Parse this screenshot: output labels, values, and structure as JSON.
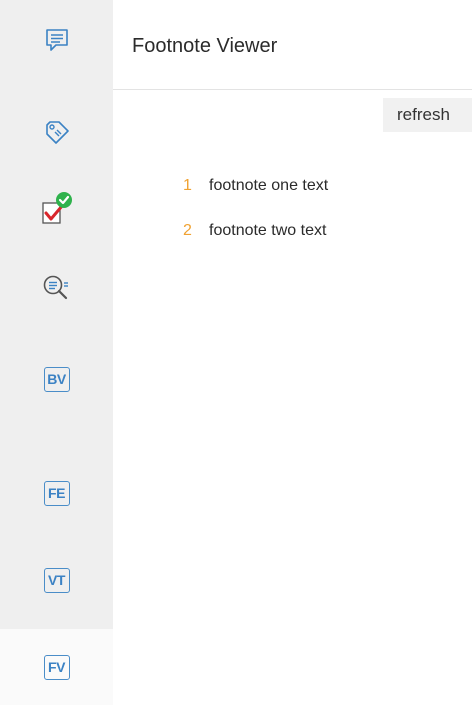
{
  "rail": {
    "items": [
      {
        "icon": "comment-lines-icon",
        "active": false
      },
      {
        "icon": "tag-icon",
        "active": false
      },
      {
        "icon": "checklist-done-icon",
        "active": false
      },
      {
        "icon": "search-list-icon",
        "active": false
      },
      {
        "label": "BV",
        "active": false
      },
      {
        "label": "FE",
        "active": false
      },
      {
        "label": "VT",
        "active": false
      },
      {
        "label": "FV",
        "active": true
      }
    ]
  },
  "header": {
    "title": "Footnote Viewer"
  },
  "toolbar": {
    "refresh_label": "refresh"
  },
  "footnotes": [
    {
      "number": "1",
      "text": "footnote one text"
    },
    {
      "number": "2",
      "text": "footnote two text"
    }
  ],
  "colors": {
    "accent_number": "#f0a232",
    "badge_blue": "#3b82c4",
    "check_green": "#2fb24c",
    "check_red": "#d9262c"
  }
}
